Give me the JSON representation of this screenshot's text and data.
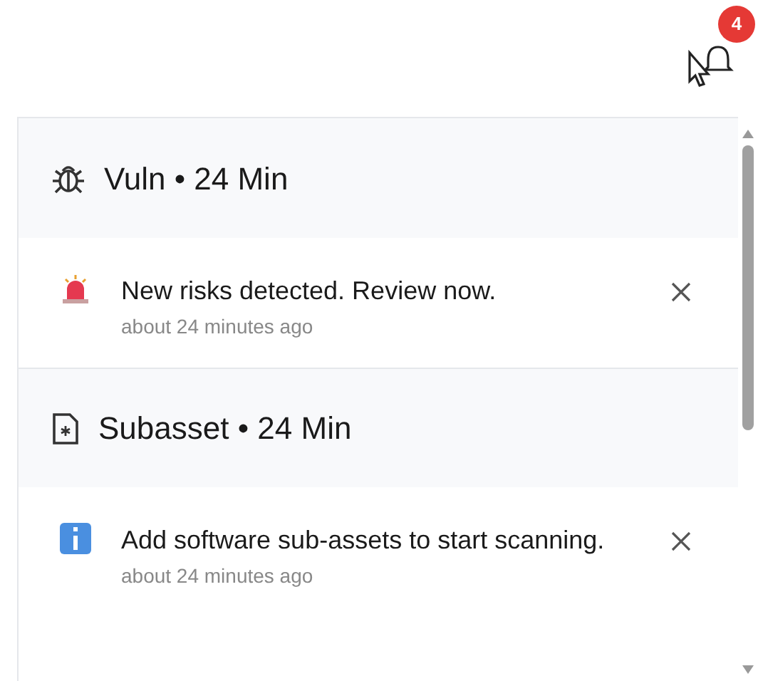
{
  "bell": {
    "badge": "4"
  },
  "groups": [
    {
      "kind": "bug",
      "title": "Vuln • 24 Min",
      "notifications": [
        {
          "kind": "alert",
          "message": "New risks detected. Review now.",
          "time": "about 24 minutes ago"
        }
      ]
    },
    {
      "kind": "file",
      "title": "Subasset • 24 Min",
      "notifications": [
        {
          "kind": "info",
          "message": "Add software sub-assets to start scanning.",
          "time": "about 24 minutes ago"
        }
      ]
    }
  ]
}
